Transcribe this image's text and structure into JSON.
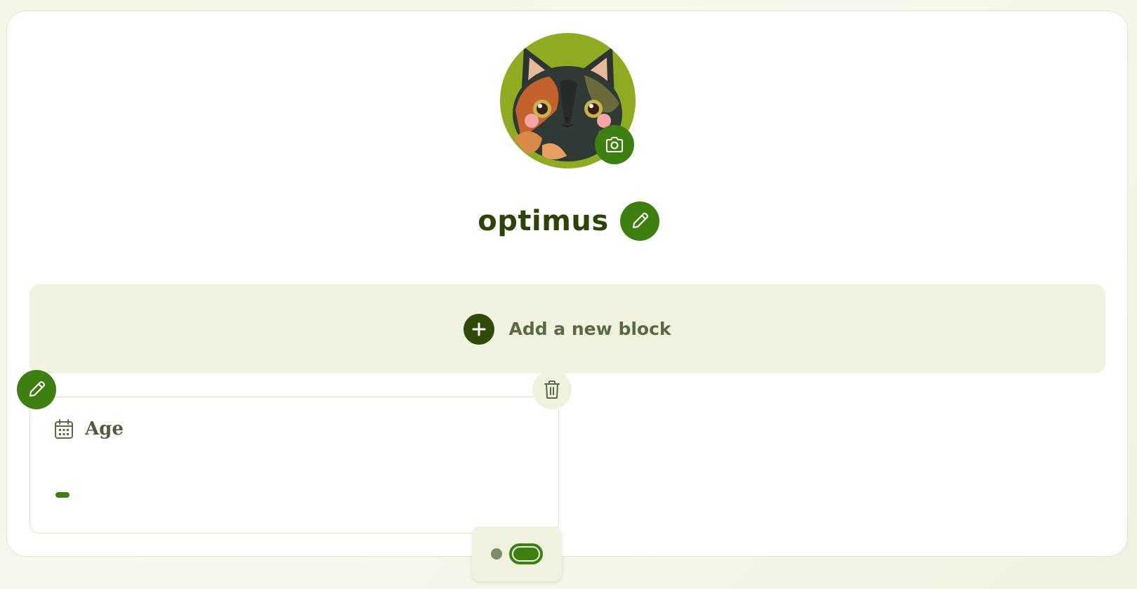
{
  "profile": {
    "name": "optimus",
    "avatar_icon": "calico-cat-avatar",
    "camera_icon": "camera-icon",
    "edit_icon": "pencil-icon"
  },
  "add_block": {
    "label": "Add a new block",
    "icon": "plus-icon"
  },
  "blocks": [
    {
      "title": "Age",
      "icon": "calendar-icon",
      "value_placeholder": "–"
    }
  ],
  "pager": {
    "pages": 2,
    "active_index": 1
  },
  "colors": {
    "accent": "#3e7f12",
    "dark_green": "#2c4408",
    "avatar_bg": "#8eab22",
    "block_bg": "#f2f2e0"
  }
}
